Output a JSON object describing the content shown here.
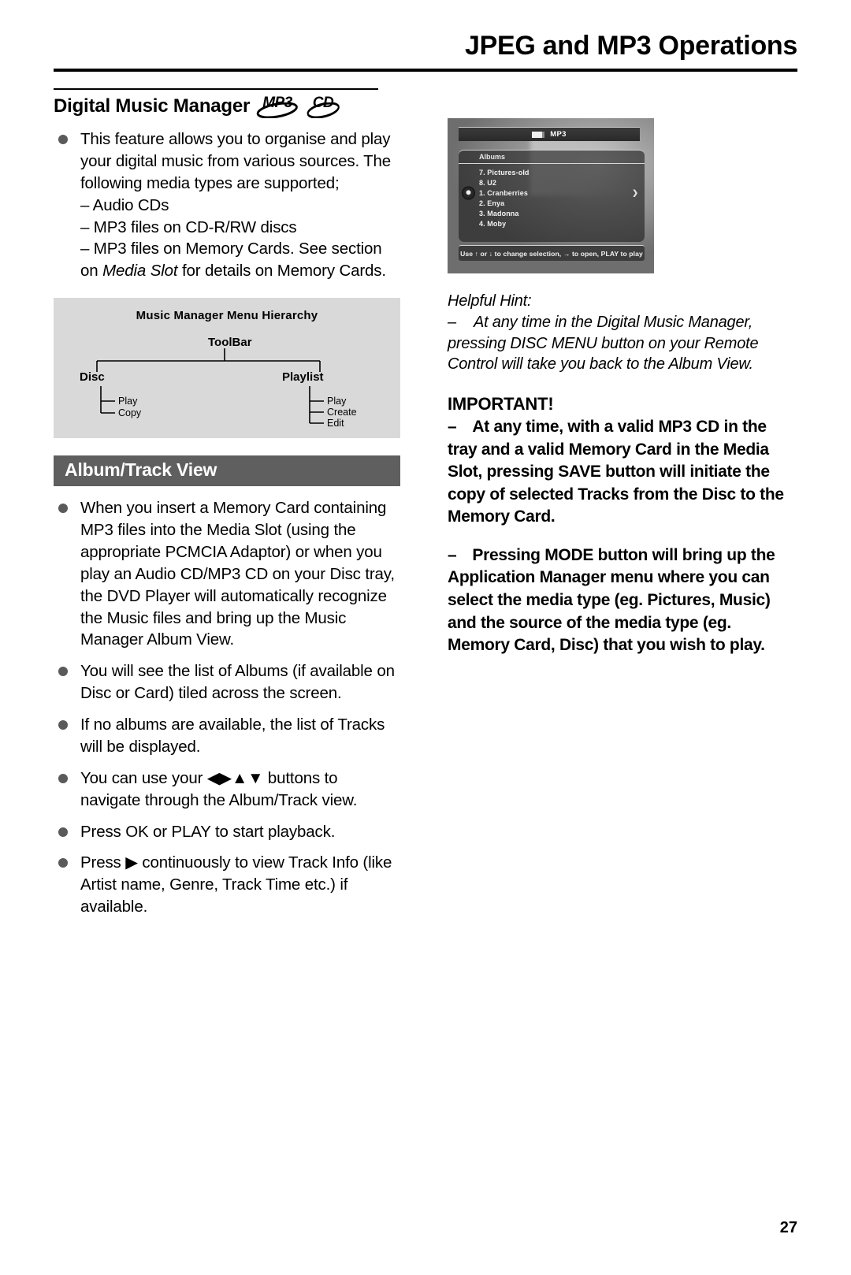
{
  "header": {
    "title": "JPEG and MP3 Operations"
  },
  "left_column": {
    "section_title": "Digital Music Manager",
    "badges": [
      {
        "label": "MP3",
        "icon": "mp3-disc-badge"
      },
      {
        "label": "CD",
        "icon": "cd-disc-badge"
      }
    ],
    "intro_bullets": [
      {
        "main": "This feature allows you to organise and play your digital music from various sources. The following media types are supported;",
        "sub": [
          "– Audio CDs",
          "– MP3 files on CD-R/RW discs"
        ],
        "sub_mixed_prefix": "– MP3 files on Memory Cards. See section on ",
        "sub_mixed_italic": "Media Slot",
        "sub_mixed_suffix": " for details on Memory Cards."
      }
    ],
    "diagram": {
      "title": "Music Manager Menu Hierarchy",
      "root": "ToolBar",
      "branches": [
        {
          "label": "Disc",
          "children": [
            "Play",
            "Copy"
          ]
        },
        {
          "label": "Playlist",
          "children": [
            "Play",
            "Create",
            "Edit"
          ]
        }
      ]
    },
    "album_track_section": {
      "bar_label": "Album/Track View",
      "bullets": [
        "When you insert a Memory Card containing MP3 files into the Media Slot (using the appropriate PCMCIA Adaptor) or when you play an Audio CD/MP3 CD on your Disc tray, the DVD Player will automatically recognize the Music files and bring up the Music Manager Album View.",
        "You will see the list of Albums (if available on Disc or Card) tiled across the screen.",
        "If no albums are available, the list of Tracks will be displayed.",
        "You can use your ◀▶▲▼ buttons to navigate through the Album/Track view.",
        "Press OK or PLAY to start playback.",
        "Press ▶ continuously to view Track Info (like Artist name, Genre, Track Time etc.) if available."
      ]
    }
  },
  "right_column": {
    "tv_screenshot": {
      "title_bar": "MP3",
      "title_bar_icon": "memory-card-icon",
      "panel_header": "Albums",
      "list_items": [
        "7. Pictures-old",
        "8. U2",
        "1. Cranberries",
        "2. Enya",
        "3. Madonna",
        "4. Moby"
      ],
      "selected_index": 2,
      "status_bar": "Use ↑ or ↓ to change selection, → to open, PLAY to play"
    },
    "helpful_hint": {
      "label": "Helpful Hint:",
      "dash": "–",
      "body": "At any time in the Digital Music Manager, pressing DISC MENU button on your Remote Control will take you back to the Album View."
    },
    "important": {
      "title": "IMPORTANT!",
      "paragraphs": [
        {
          "dash": "–",
          "text": "At any time, with a valid MP3 CD in the tray and a valid Memory Card in the Media Slot, pressing SAVE button will initiate the copy of selected Tracks from the Disc to the Memory Card."
        },
        {
          "dash": "–",
          "text": "Pressing MODE button will bring up the Application Manager menu where you can select the media type (eg. Pictures, Music) and the source of the media type (eg. Memory Card, Disc) that you wish to play."
        }
      ]
    }
  },
  "footer": {
    "page_number": "27"
  },
  "colors": {
    "bar_background": "#5f5f5f",
    "diagram_background": "#d9d9d9",
    "bullet": "#5a5a5a",
    "text": "#000000"
  }
}
